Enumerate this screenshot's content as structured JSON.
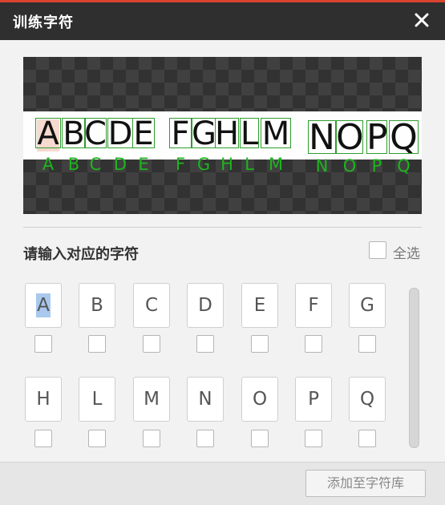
{
  "window": {
    "title": "训练字符"
  },
  "preview": {
    "ocr_text": [
      "A",
      "B",
      "C",
      "D",
      "E",
      "F",
      "G",
      "H",
      "L",
      "M",
      "N",
      "O",
      "P",
      "Q"
    ],
    "box_color": "#2e9e2e",
    "label_color": "#1db51d",
    "selected_char_index": 0
  },
  "section": {
    "title": "请输入对应的字符"
  },
  "select_all": {
    "label": "全选",
    "checked": false
  },
  "inputs": {
    "row1": [
      "A",
      "B",
      "C",
      "D",
      "E",
      "F",
      "G"
    ],
    "row2": [
      "H",
      "L",
      "M",
      "N",
      "O",
      "P",
      "Q"
    ],
    "active_index": 0
  },
  "footer": {
    "add_button_label": "添加至字符库"
  },
  "icons": {
    "close": "close-icon"
  },
  "colors": {
    "titlebar": "#2f2f2f",
    "accent_red": "#d9442e",
    "selection_blue": "#a8c8ee"
  }
}
